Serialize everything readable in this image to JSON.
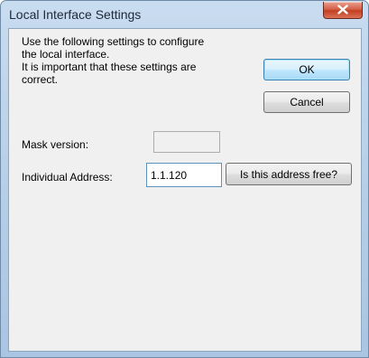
{
  "window": {
    "title": "Local Interface Settings"
  },
  "description": {
    "line1": "Use the following settings to configure",
    "line2": "the local interface.",
    "line3": "It is important that these settings are",
    "line4": "correct."
  },
  "buttons": {
    "ok_label": "OK",
    "cancel_label": "Cancel",
    "address_free_label": "Is this address free?"
  },
  "fields": {
    "mask_version_label": "Mask version:",
    "mask_version_value": "",
    "individual_address_label": "Individual Address:",
    "individual_address_value": "1.1.120"
  },
  "icons": {
    "close": "close-icon"
  }
}
